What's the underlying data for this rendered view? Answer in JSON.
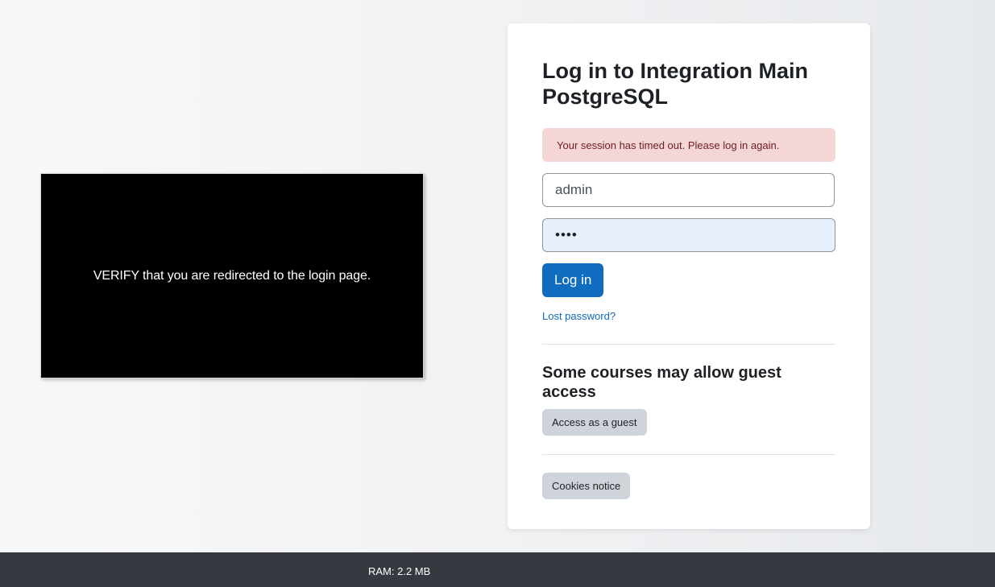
{
  "overlay": {
    "instruction": "VERIFY that you are redirected to the login page."
  },
  "login": {
    "title": "Log in to Integration Main PostgreSQL",
    "alert_message": "Your session has timed out. Please log in again.",
    "username_value": "admin",
    "password_masked": "••••",
    "login_button_label": "Log in",
    "lost_password_link": "Lost password?"
  },
  "guest": {
    "heading": "Some courses may allow guest access",
    "button_label": "Access as a guest"
  },
  "cookies": {
    "button_label": "Cookies notice"
  },
  "footer": {
    "ram_text": "RAM: 2.2 MB"
  },
  "colors": {
    "primary": "#0f6cbf",
    "alert_bg": "#f3d6d5",
    "alert_text": "#6e1d24",
    "secondary_button": "#ced4da",
    "footer_bg": "#343a40",
    "autofill_bg": "#e8f0fe"
  }
}
